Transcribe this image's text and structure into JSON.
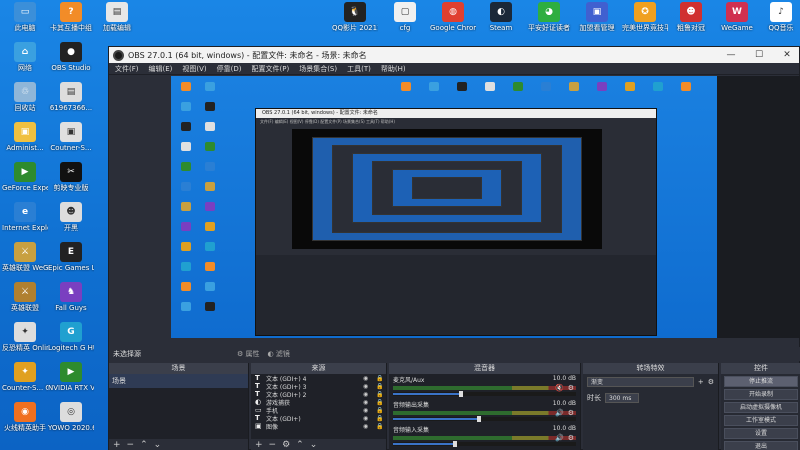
{
  "desktop": {
    "icons": [
      {
        "label": "此电脑",
        "color": "#3b8fd9",
        "glyph": "▭"
      },
      {
        "label": "卡其互播中组",
        "color": "#f28c28",
        "glyph": "?"
      },
      {
        "label": "加载编辑",
        "color": "#e7e7e7",
        "glyph": "▤"
      },
      {
        "label": "网络",
        "color": "#3aa0e0",
        "glyph": "⌂"
      },
      {
        "label": "OBS Studio",
        "color": "#222222",
        "glyph": "●"
      },
      {
        "label": "回收站",
        "color": "#8fb6d8",
        "glyph": "♲"
      },
      {
        "label": "61967366...",
        "color": "#dddddd",
        "glyph": "▤"
      },
      {
        "label": "Administ...",
        "color": "#f0c040",
        "glyph": "▣"
      },
      {
        "label": "Coutner-S...",
        "color": "#e0e0e0",
        "glyph": "▣"
      },
      {
        "label": "GeForce Experience",
        "color": "#2e8b2e",
        "glyph": "▶"
      },
      {
        "label": "剪映专业版",
        "color": "#111111",
        "glyph": "✂"
      },
      {
        "label": "Internet Explorer",
        "color": "#2a7fd4",
        "glyph": "e"
      },
      {
        "label": "开黑",
        "color": "#dddddd",
        "glyph": "☻"
      },
      {
        "label": "英雄联盟 WeGame版",
        "color": "#c8a040",
        "glyph": "⚔"
      },
      {
        "label": "Epic Games Launcher",
        "color": "#222222",
        "glyph": "E"
      },
      {
        "label": "英雄联盟",
        "color": "#b08030",
        "glyph": "⚔"
      },
      {
        "label": "Fall Guys",
        "color": "#7a3fc0",
        "glyph": "♞"
      },
      {
        "label": "反恐精英 Online",
        "color": "#dddddd",
        "glyph": "✦"
      },
      {
        "label": "Logitech G HUB 9.04",
        "color": "#20a0d0",
        "glyph": "G"
      },
      {
        "label": "Counter-S... Global Off...",
        "color": "#e0a020",
        "glyph": "✦"
      },
      {
        "label": "NVIDIA RTX Voice",
        "color": "#2e8b2e",
        "glyph": "▶"
      },
      {
        "label": "火线精英助手",
        "color": "#f07020",
        "glyph": "◉"
      },
      {
        "label": "YOWO 2020.6.3",
        "color": "#dddddd",
        "glyph": "◎"
      },
      {
        "label": "QQ影片 20211203...",
        "color": "#222222",
        "glyph": "🐧"
      },
      {
        "label": "cfg",
        "color": "#f0f0f0",
        "glyph": "▢"
      },
      {
        "label": "Google Chrome",
        "color": "#e04030",
        "glyph": "◍"
      },
      {
        "label": "Steam",
        "color": "#1b2838",
        "glyph": "◐"
      },
      {
        "label": "平安好证读者",
        "color": "#2eae40",
        "glyph": "◕"
      },
      {
        "label": "加盟看管理",
        "color": "#4060d0",
        "glyph": "▣"
      },
      {
        "label": "完美世界竞技平台",
        "color": "#f0a020",
        "glyph": "✪"
      },
      {
        "label": "粗鲁对冠",
        "color": "#d03030",
        "glyph": "☻"
      },
      {
        "label": "WeGame",
        "color": "#d03050",
        "glyph": "W"
      },
      {
        "label": "QQ音乐",
        "color": "#ffffff",
        "glyph": "♪"
      }
    ]
  },
  "obs": {
    "title": "OBS 27.0.1 (64 bit, windows) - 配置文件: 未命名 - 场景: 未命名",
    "menu": [
      "文件(F)",
      "编辑(E)",
      "视图(V)",
      "停靠(D)",
      "配置文件(P)",
      "场景集合(S)",
      "工具(T)",
      "帮助(H)"
    ],
    "window_buttons": [
      "—",
      "☐",
      "✕"
    ],
    "preview_inner_title": "OBS 27.0.1 (64 bit, windows) - 配置文件: 未命名",
    "preview_inner_menu": "文件(F) 编辑(E) 视图(V) 停靠(D) 配置文件(P) 场景集合(S) 工具(T) 帮助(H)",
    "bottom_bar": {
      "label": "未选择源",
      "properties": "属性",
      "filters": "滤镜"
    },
    "scenes": {
      "header": "场景",
      "items": [
        "场景"
      ]
    },
    "sources": {
      "header": "来源",
      "items": [
        {
          "type": "T",
          "name": "文本 (GDI+) 4"
        },
        {
          "type": "T",
          "name": "文本 (GDI+) 3"
        },
        {
          "type": "T",
          "name": "文本 (GDI+) 2"
        },
        {
          "type": "◐",
          "name": "游戏捕获"
        },
        {
          "type": "▭",
          "name": "手机"
        },
        {
          "type": "T",
          "name": "文本 (GDI+)"
        },
        {
          "type": "▣",
          "name": "图像"
        }
      ]
    },
    "mixer": {
      "header": "混音器",
      "channels": [
        {
          "name": "麦克风/Aux",
          "db": "10.0 dB",
          "level": 0.55,
          "muted": true
        },
        {
          "name": "音频输出采集",
          "db": "10.0 dB",
          "level": 0.7,
          "muted": false
        },
        {
          "name": "音频输入采集",
          "db": "10.0 dB",
          "level": 0.5,
          "muted": false
        }
      ]
    },
    "transitions": {
      "header": "转场特效",
      "selected": "渐变",
      "duration_label": "时长",
      "duration_value": "300 ms"
    },
    "controls": {
      "header": "控件",
      "buttons": [
        "停止推流",
        "开始录制",
        "启动虚拟摄像机",
        "工作室模式",
        "设置",
        "退出"
      ]
    }
  }
}
